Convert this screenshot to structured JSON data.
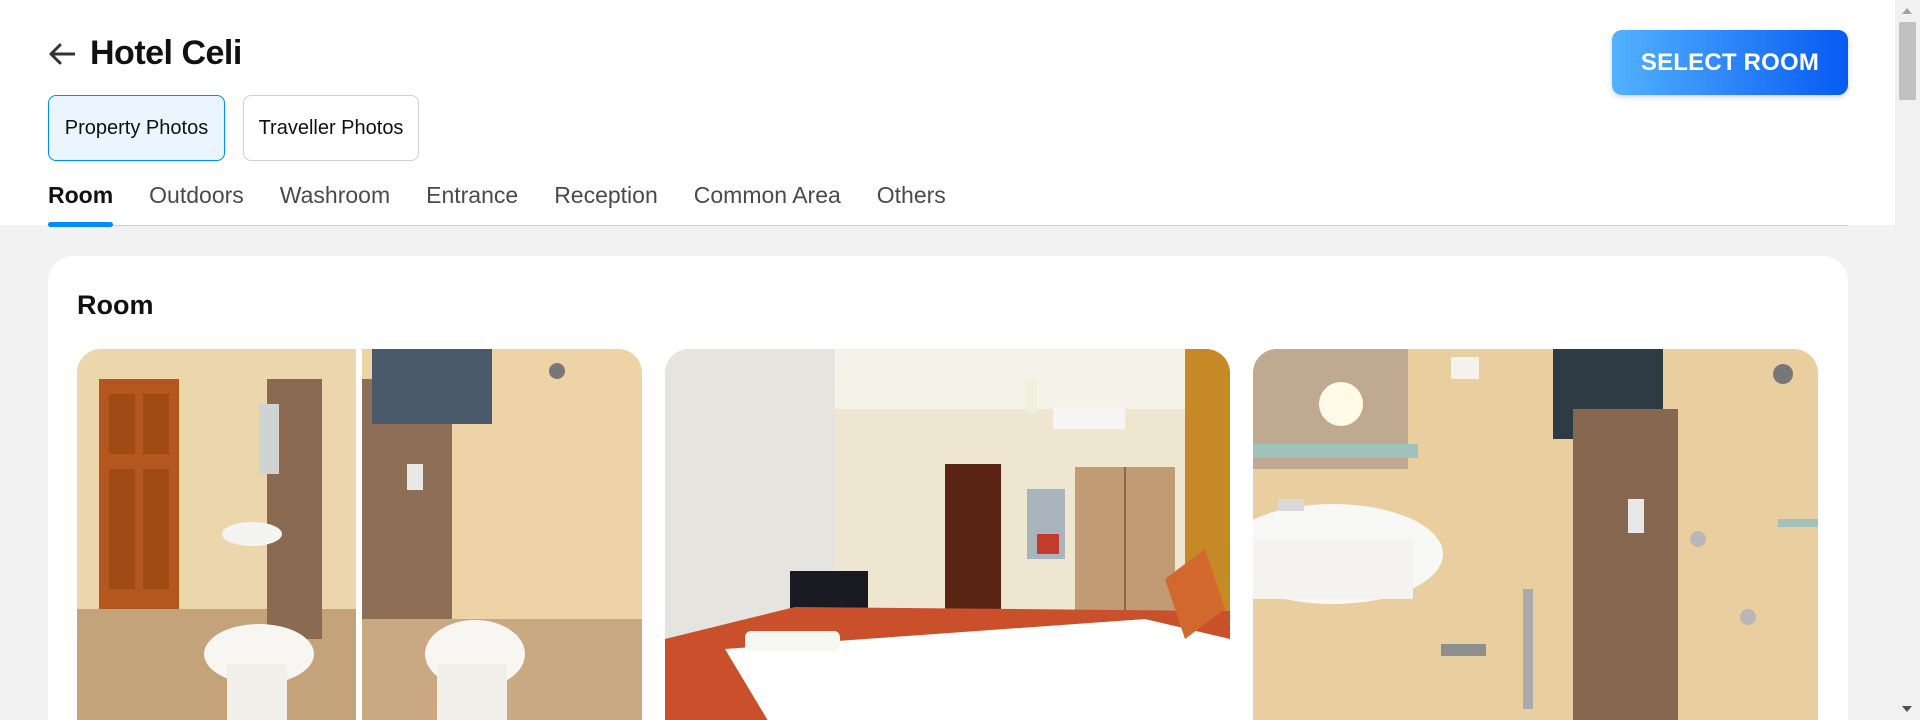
{
  "header": {
    "title": "Hotel Celi",
    "back_icon": "back-arrow-icon"
  },
  "actions": {
    "select_room_label": "SELECT ROOM",
    "accent_gradient": [
      "#53b2fe",
      "#065af3"
    ]
  },
  "photo_source": {
    "selected": "Property Photos",
    "options": [
      {
        "label": "Property Photos",
        "active": true
      },
      {
        "label": "Traveller Photos",
        "active": false
      }
    ]
  },
  "tabs": [
    {
      "label": "Room",
      "active": true
    },
    {
      "label": "Outdoors",
      "active": false
    },
    {
      "label": "Washroom",
      "active": false
    },
    {
      "label": "Entrance",
      "active": false
    },
    {
      "label": "Reception",
      "active": false
    },
    {
      "label": "Common Area",
      "active": false
    },
    {
      "label": "Others",
      "active": false
    }
  ],
  "section": {
    "title": "Room",
    "photos": [
      {
        "subject": "bathroom-toilet-shower-split-view"
      },
      {
        "subject": "bedroom-with-bed-and-wardrobe"
      },
      {
        "subject": "bathroom-sink-and-shower"
      }
    ]
  },
  "colors": {
    "active_tab_underline": "#008cff",
    "active_toggle_bg": "#eaf5ff",
    "page_bg": "#f2f2f2"
  }
}
